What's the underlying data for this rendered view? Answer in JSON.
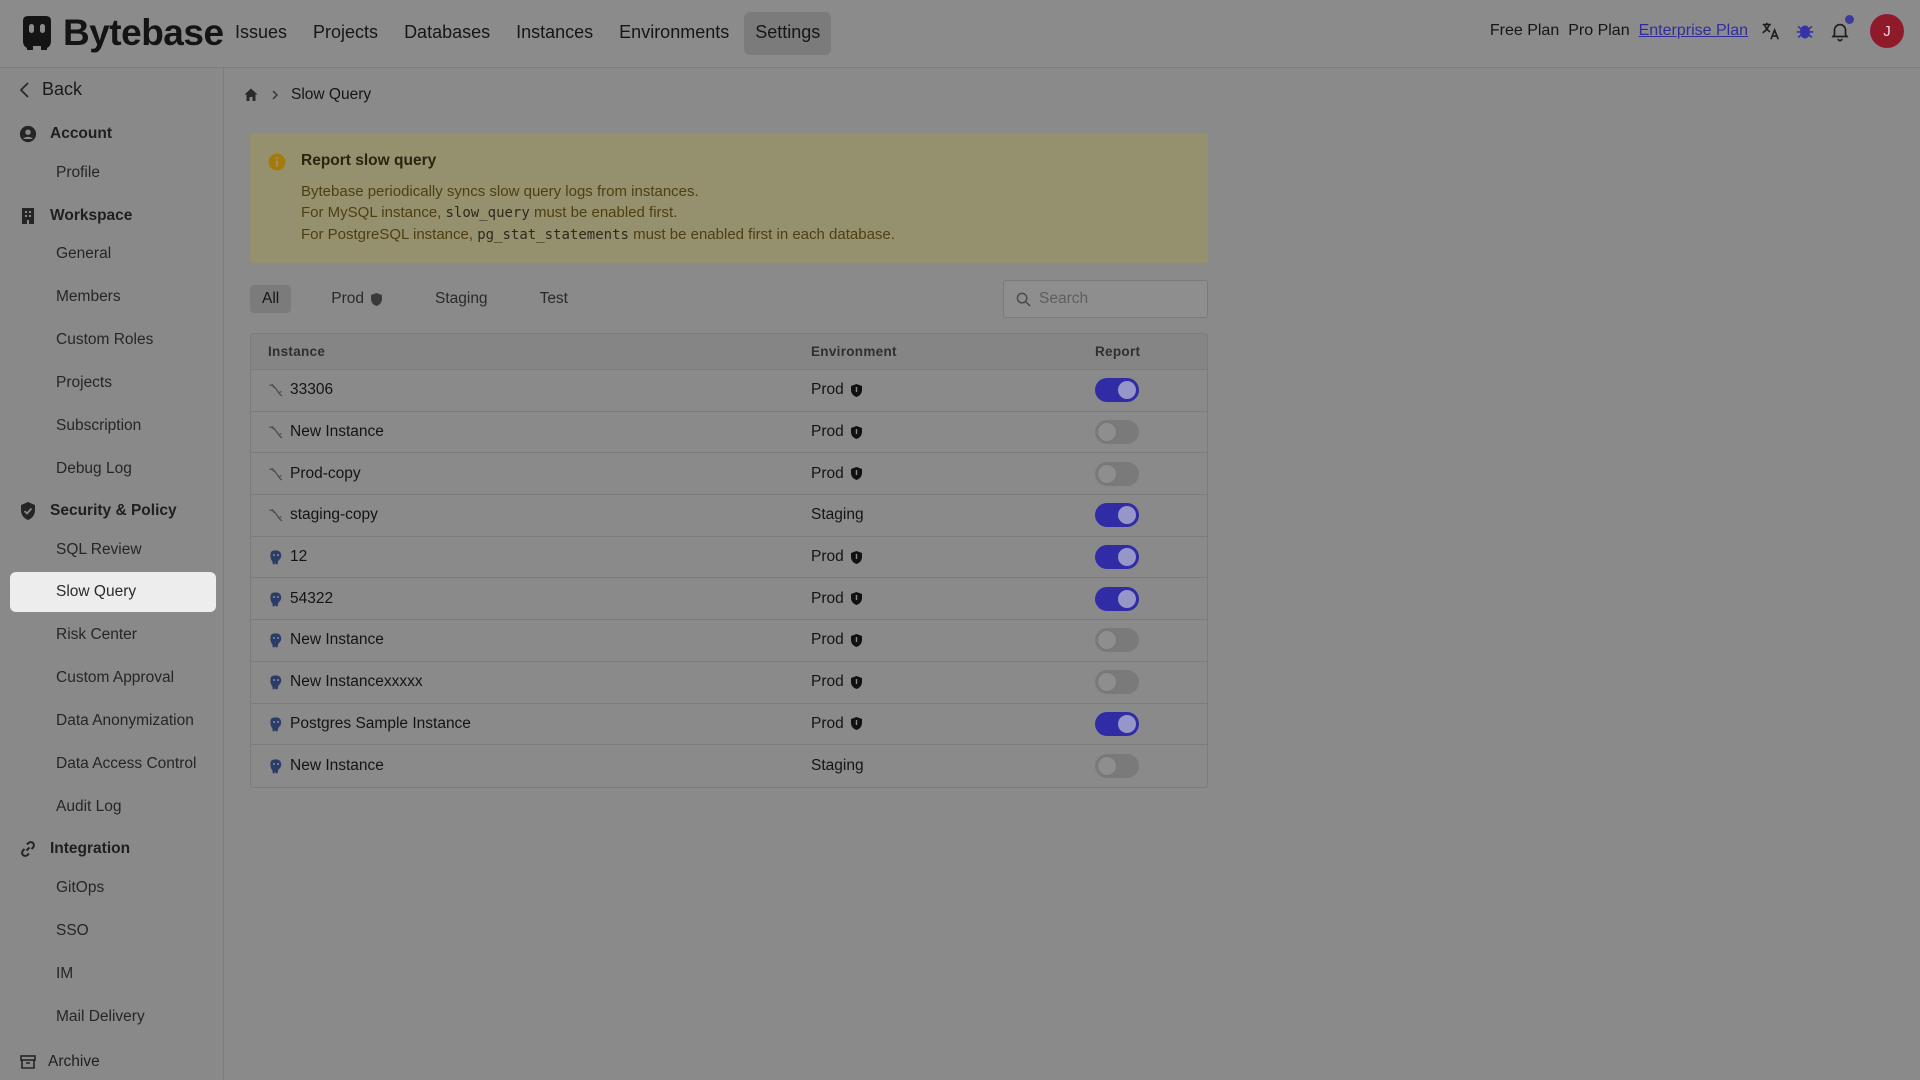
{
  "app": {
    "name": "Bytebase"
  },
  "topnav": {
    "items": [
      {
        "label": "Issues",
        "active": false
      },
      {
        "label": "Projects",
        "active": false
      },
      {
        "label": "Databases",
        "active": false
      },
      {
        "label": "Instances",
        "active": false
      },
      {
        "label": "Environments",
        "active": false
      },
      {
        "label": "Settings",
        "active": true
      }
    ]
  },
  "topright": {
    "free_plan": "Free Plan",
    "pro_plan": "Pro Plan",
    "enterprise_plan": "Enterprise Plan",
    "avatar_initial": "J"
  },
  "sidebar": {
    "back": "Back",
    "account": "Account",
    "profile": "Profile",
    "workspace": "Workspace",
    "workspace_items": [
      "General",
      "Members",
      "Custom Roles",
      "Projects",
      "Subscription",
      "Debug Log"
    ],
    "security": "Security & Policy",
    "security_items": [
      "SQL Review",
      "Slow Query",
      "Risk Center",
      "Custom Approval",
      "Data Anonymization",
      "Data Access Control",
      "Audit Log"
    ],
    "integration": "Integration",
    "integration_items": [
      "GitOps",
      "SSO",
      "IM",
      "Mail Delivery"
    ],
    "archive": "Archive",
    "active_item": "Slow Query"
  },
  "breadcrumb": {
    "current": "Slow Query"
  },
  "alert": {
    "title": "Report slow query",
    "line1": "Bytebase periodically syncs slow query logs from instances.",
    "line2_pre": "For MySQL instance, ",
    "line2_code": "slow_query",
    "line2_post": " must be enabled first.",
    "line3_pre": "For PostgreSQL instance, ",
    "line3_code": "pg_stat_statements",
    "line3_post": " must be enabled first in each database."
  },
  "tabs": {
    "all": "All",
    "prod": "Prod",
    "staging": "Staging",
    "test": "Test"
  },
  "search": {
    "placeholder": "Search"
  },
  "table": {
    "headers": {
      "instance": "Instance",
      "environment": "Environment",
      "report": "Report"
    },
    "rows": [
      {
        "engine": "mysql",
        "instance": "33306",
        "environment": "Prod",
        "protected": true,
        "report": true
      },
      {
        "engine": "mysql",
        "instance": "New Instance",
        "environment": "Prod",
        "protected": true,
        "report": false
      },
      {
        "engine": "mysql",
        "instance": "Prod-copy",
        "environment": "Prod",
        "protected": true,
        "report": false
      },
      {
        "engine": "mysql",
        "instance": "staging-copy",
        "environment": "Staging",
        "protected": false,
        "report": true
      },
      {
        "engine": "postgres",
        "instance": "12",
        "environment": "Prod",
        "protected": true,
        "report": true
      },
      {
        "engine": "postgres",
        "instance": "54322",
        "environment": "Prod",
        "protected": true,
        "report": true
      },
      {
        "engine": "postgres",
        "instance": "New Instance",
        "environment": "Prod",
        "protected": true,
        "report": false
      },
      {
        "engine": "postgres",
        "instance": "New Instancexxxxx",
        "environment": "Prod",
        "protected": true,
        "report": false
      },
      {
        "engine": "postgres",
        "instance": "Postgres Sample Instance",
        "environment": "Prod",
        "protected": true,
        "report": true
      },
      {
        "engine": "postgres",
        "instance": "New Instance",
        "environment": "Staging",
        "protected": false,
        "report": false
      }
    ]
  }
}
